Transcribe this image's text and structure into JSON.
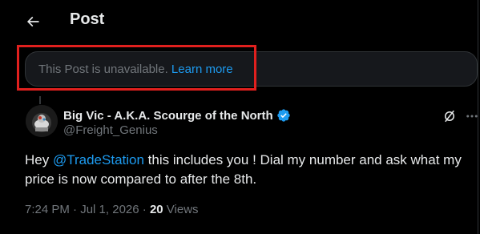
{
  "header": {
    "title": "Post"
  },
  "unavailable": {
    "text": "This Post is unavailable.",
    "link": "Learn more"
  },
  "author": {
    "name": "Big Vic - A.K.A. Scourge of the North",
    "handle": "@Freight_Genius"
  },
  "post": {
    "before": "Hey ",
    "mention": "@TradeStation",
    "after": " this includes you ! Dial my number and ask what my price is now compared to after the 8th."
  },
  "meta": {
    "time": "7:24 PM",
    "sep1": " · ",
    "date": "Jul 1, 2026",
    "sep2": " · ",
    "views_count": "20",
    "views_label": " Views"
  },
  "colors": {
    "background": "#000000",
    "text": "#e7e9ea",
    "muted": "#71767b",
    "accent": "#1d9bf0",
    "highlight": "#e0201e"
  },
  "icons": {
    "back": "arrow-left-icon",
    "verified": "verified-badge-icon",
    "grok": "grok-icon",
    "more": "more-horizontal-icon"
  }
}
